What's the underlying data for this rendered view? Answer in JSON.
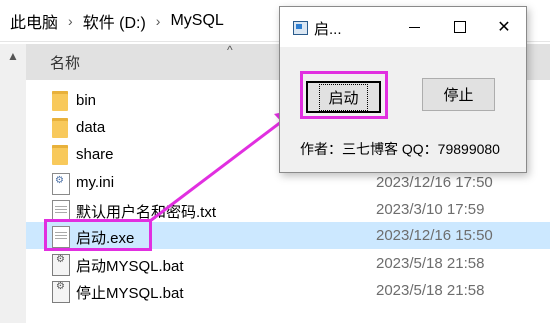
{
  "breadcrumb": [
    "此电脑",
    "软件 (D:)",
    "MySQL"
  ],
  "column_header": {
    "name": "名称"
  },
  "files": [
    {
      "name": "bin",
      "date": "",
      "type": "folder"
    },
    {
      "name": "data",
      "date": "",
      "type": "folder"
    },
    {
      "name": "share",
      "date": "",
      "type": "folder"
    },
    {
      "name": "my.ini",
      "date": "2023/12/16 17:50",
      "type": "ini"
    },
    {
      "name": "默认用户名和密码.txt",
      "date": "2023/3/10 17:59",
      "type": "txt"
    },
    {
      "name": "启动.exe",
      "date": "2023/12/16 15:50",
      "type": "exe"
    },
    {
      "name": "启动MYSQL.bat",
      "date": "2023/5/18 21:58",
      "type": "bat"
    },
    {
      "name": "停止MYSQL.bat",
      "date": "2023/5/18 21:58",
      "type": "bat"
    }
  ],
  "dialog": {
    "title": "启...",
    "start_label": "启动",
    "stop_label": "停止",
    "author_text": "作者：三七博客 QQ：79899080"
  },
  "colors": {
    "annotation": "#e12fe0",
    "selected_row": "#cce8ff"
  }
}
